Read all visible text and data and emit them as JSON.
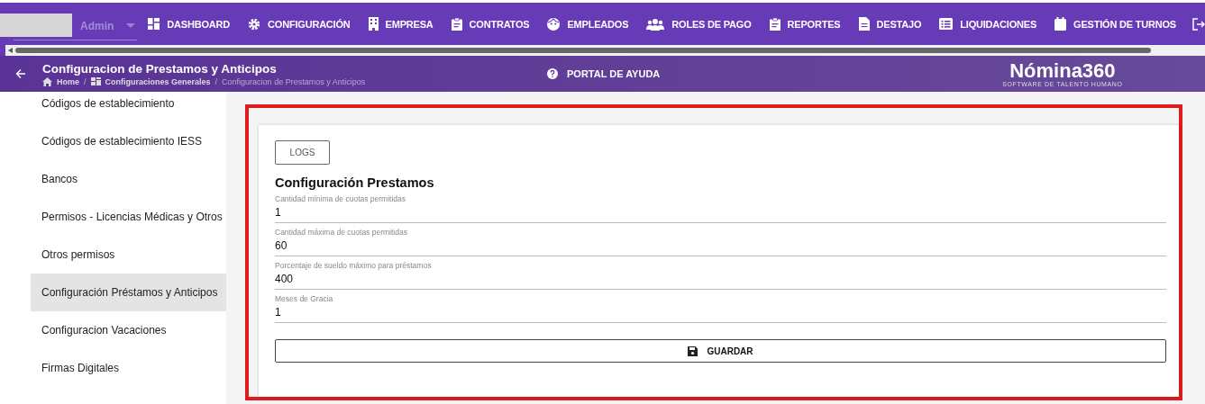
{
  "topbar": {
    "user_select": {
      "value": "Admin"
    },
    "nav": [
      {
        "label": "DASHBOARD",
        "kind": "grid"
      },
      {
        "label": "CONFIGURACIÓN",
        "kind": "gear"
      },
      {
        "label": "EMPRESA",
        "kind": "building"
      },
      {
        "label": "CONTRATOS",
        "kind": "clipboard"
      },
      {
        "label": "EMPLEADOS",
        "kind": "face"
      },
      {
        "label": "ROLES DE PAGO",
        "kind": "people"
      },
      {
        "label": "REPORTES",
        "kind": "clipboard"
      },
      {
        "label": "DESTAJO",
        "kind": "document"
      },
      {
        "label": "LIQUIDACIONES",
        "kind": "list"
      },
      {
        "label": "GESTIÓN DE TURNOS",
        "kind": "calendar"
      }
    ]
  },
  "header": {
    "title": "Configuracion de Prestamos y Anticipos",
    "breadcrumb": [
      {
        "label": "Home",
        "kind": "home"
      },
      {
        "label": "Configuraciones Generales",
        "kind": "dashboard"
      },
      {
        "label": "Configuracion de Prestamos y Anticipos",
        "kind": "current"
      }
    ],
    "breadcrumb_separator": "/",
    "help_link": "PORTAL DE AYUDA",
    "logo": {
      "name": "Nómina360",
      "tagline": "SOFTWARE DE TALENTO HUMANO"
    }
  },
  "sidebar": {
    "items": [
      {
        "label": "Códigos de establecimiento",
        "selected": false
      },
      {
        "label": "Códigos de establecimiento IESS",
        "selected": false
      },
      {
        "label": "Bancos",
        "selected": false
      },
      {
        "label": "Permisos - Licencias Médicas y Otros",
        "selected": false
      },
      {
        "label": "Otros permisos",
        "selected": false
      },
      {
        "label": "Configuración Préstamos y Anticipos",
        "selected": true
      },
      {
        "label": "Configuracion Vacaciones",
        "selected": false
      },
      {
        "label": "Firmas Digitales",
        "selected": false
      }
    ]
  },
  "form": {
    "logs_button": "LOGS",
    "title": "Configuración Prestamos",
    "fields": [
      {
        "label": "Cantidad mínima de cuotas permitidas",
        "value": "1"
      },
      {
        "label": "Cantidad máxima de cuotas permitidas",
        "value": "60"
      },
      {
        "label": "Porcentaje de sueldo máximo para préstamos",
        "value": "400"
      },
      {
        "label": "Meses de Gracia",
        "value": "1"
      }
    ],
    "save_button": "GUARDAR"
  }
}
